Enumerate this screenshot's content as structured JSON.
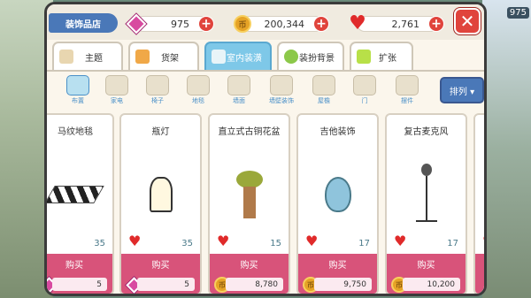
{
  "shop_title": "装饰品店",
  "currency": {
    "gems": "975",
    "coins": "200,344",
    "hearts": "2,761"
  },
  "background_stat": "975",
  "close_label": "✕",
  "tabs": [
    {
      "label": "主题",
      "active": false
    },
    {
      "label": "货架",
      "active": false
    },
    {
      "label": "室内装潢",
      "active": true
    },
    {
      "label": "装扮背景",
      "active": false
    },
    {
      "label": "扩张",
      "active": false
    }
  ],
  "subcategories": [
    {
      "label": "布置",
      "active": true
    },
    {
      "label": "家电",
      "active": false
    },
    {
      "label": "椅子",
      "active": false
    },
    {
      "label": "地毯",
      "active": false
    },
    {
      "label": "墙面",
      "active": false
    },
    {
      "label": "墙壁装饰",
      "active": false
    },
    {
      "label": "屋檐",
      "active": false
    },
    {
      "label": "门",
      "active": false
    },
    {
      "label": "摆件",
      "active": false
    }
  ],
  "sort_label": "排列 ▾",
  "items": [
    {
      "name": "马纹地毯",
      "likes": "35",
      "buy_label": "购买",
      "price": "5",
      "currency": "gem",
      "art": "rug"
    },
    {
      "name": "瓶灯",
      "likes": "35",
      "buy_label": "购买",
      "price": "5",
      "currency": "gem",
      "art": "lamp"
    },
    {
      "name": "直立式古铜花盆",
      "likes": "15",
      "buy_label": "购买",
      "price": "8,780",
      "currency": "coin",
      "art": "bonsai"
    },
    {
      "name": "吉他装饰",
      "likes": "17",
      "buy_label": "购买",
      "price": "9,750",
      "currency": "coin",
      "art": "guitar"
    },
    {
      "name": "复古麦克风",
      "likes": "17",
      "buy_label": "购买",
      "price": "10,200",
      "currency": "coin",
      "art": "mic"
    }
  ],
  "colors": {
    "accent_blue": "#4a78b8",
    "active_tab": "#7ec8e8",
    "buy_pink": "#d8537a",
    "close_red": "#e0443c"
  }
}
